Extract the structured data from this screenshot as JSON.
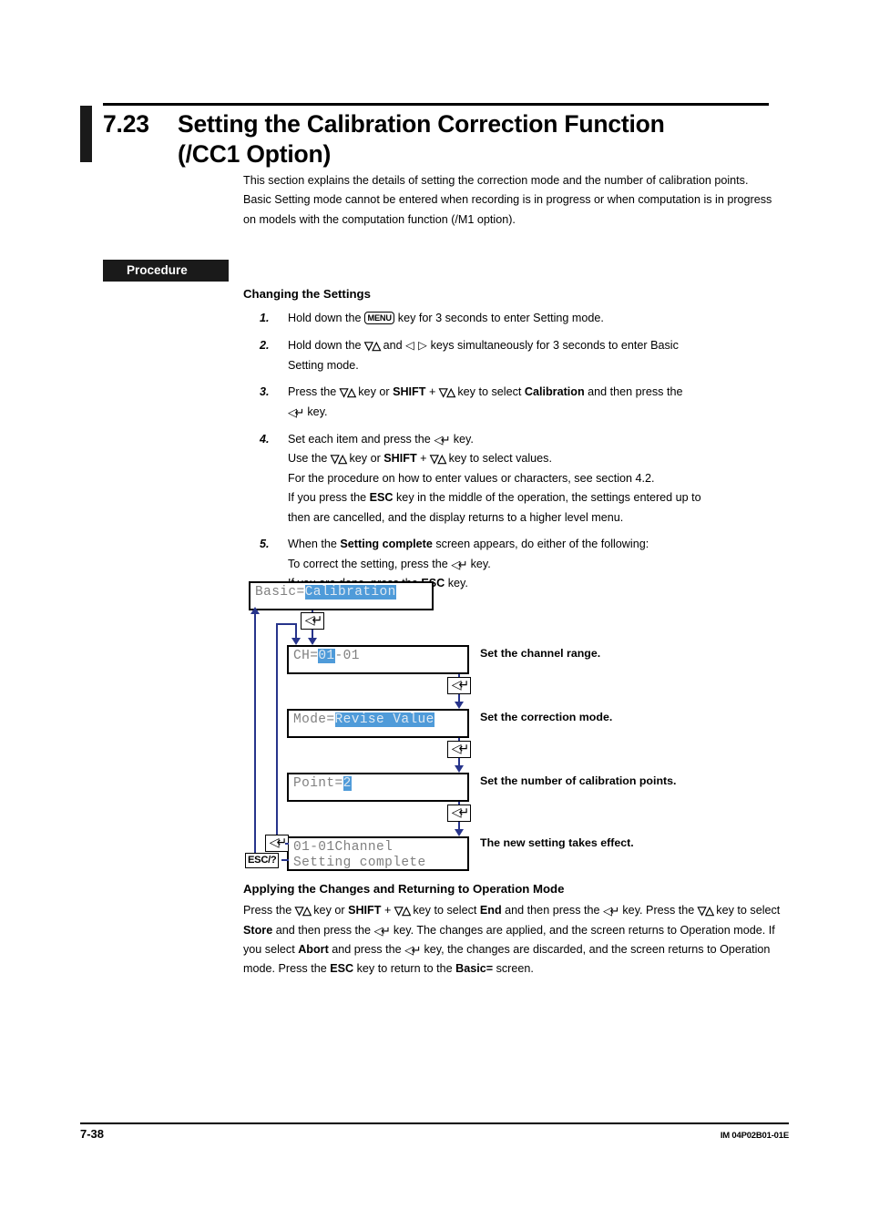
{
  "section": {
    "number": "7.23",
    "title_line1": "Setting the Calibration Correction Function",
    "title_line2": "(/CC1 Option)"
  },
  "intro": {
    "p1": "This section explains the details of setting the correction mode and the number of calibration points.",
    "p2": "Basic Setting mode cannot be entered when recording is in progress or when computation is in progress on models with the computation function (/M1 option)."
  },
  "procedure": {
    "tag": "Procedure",
    "subhead": "Changing the Settings",
    "steps": [
      {
        "num": "1.",
        "parts": [
          "Hold down the ",
          "MENU",
          " key for 3 seconds to enter Setting mode."
        ]
      },
      {
        "num": "2.",
        "line1_a": "Hold down the ",
        "line1_b": " and ",
        "line1_c": " keys simultaneously for 3 seconds to enter Basic",
        "line2": "Setting mode."
      },
      {
        "num": "3.",
        "line1_a": "Press the ",
        "line1_b": " key or ",
        "shift": "SHIFT",
        "line1_c": " + ",
        "line1_d": " key to select ",
        "target": "Calibration",
        "line1_e": " and then press the",
        "line2": " key."
      },
      {
        "num": "4.",
        "line1_a": "Set each item and press the ",
        "line1_b": " key.",
        "line2_a": "Use the ",
        "line2_b": " key or ",
        "line2_c": " + ",
        "line2_d": " key to select values.",
        "line3": "For the procedure on how to enter values or characters, see section 4.2.",
        "line4_a": "If you press the ",
        "esc": "ESC",
        "line4_b": " key in the middle of the operation, the settings entered up to",
        "line5": "then are cancelled, and the display returns to a higher level menu."
      },
      {
        "num": "5.",
        "line1_a": "When the ",
        "bold1": "Setting complete",
        "line1_b": " screen appears, do either of the following:",
        "line2_a": "To correct the setting, press the ",
        "line2_b": " key.",
        "line3_a": "If you are done, press the ",
        "bold2": "ESC",
        "line3_b": " key."
      }
    ]
  },
  "diagram": {
    "screens": [
      {
        "id": "basic",
        "prefix": "Basic=",
        "highlight": "Calibration",
        "suffix": "",
        "note": ""
      },
      {
        "id": "channel",
        "prefix": "CH=",
        "highlight": "01",
        "suffix": "-01",
        "note": "Set the channel range."
      },
      {
        "id": "mode",
        "prefix": "Mode=",
        "highlight": "Revise Value",
        "suffix": "",
        "note": "Set the correction mode."
      },
      {
        "id": "point",
        "prefix": "Point=",
        "highlight": "2",
        "suffix": "",
        "note": "Set the number of calibration points."
      },
      {
        "id": "complete",
        "line1": "01-01Channel",
        "line2": "Setting complete",
        "note": "The new setting takes effect."
      }
    ],
    "enter_key_glyph": "↵",
    "esc_key_label": "ESC/?",
    "arrow_color": "#27348b",
    "highlight_color": "#4f9bd9"
  },
  "closing": {
    "subhead": "Applying the Changes and Returning to Operation Mode",
    "t1": "Press the ",
    "t2": " key or ",
    "shift": "SHIFT",
    "t3": " + ",
    "t4": " key to select ",
    "end": "End",
    "t5": " and then press the ",
    "t6": " key. Press the ",
    "t7": " key to select ",
    "store": "Store",
    "t8": " and then press the ",
    "t9": " key. The changes are applied, and the screen returns to Operation mode. If you select ",
    "abort": "Abort",
    "t10": " and press the ",
    "t11": " key, the changes are discarded, and the screen returns to Operation mode. Press the ",
    "esc": "ESC",
    "t12": " key to return to the ",
    "basic": "Basic=",
    "t13": " screen."
  },
  "footer": {
    "page": "7-38",
    "doc": "IM 04P02B01-01E"
  }
}
